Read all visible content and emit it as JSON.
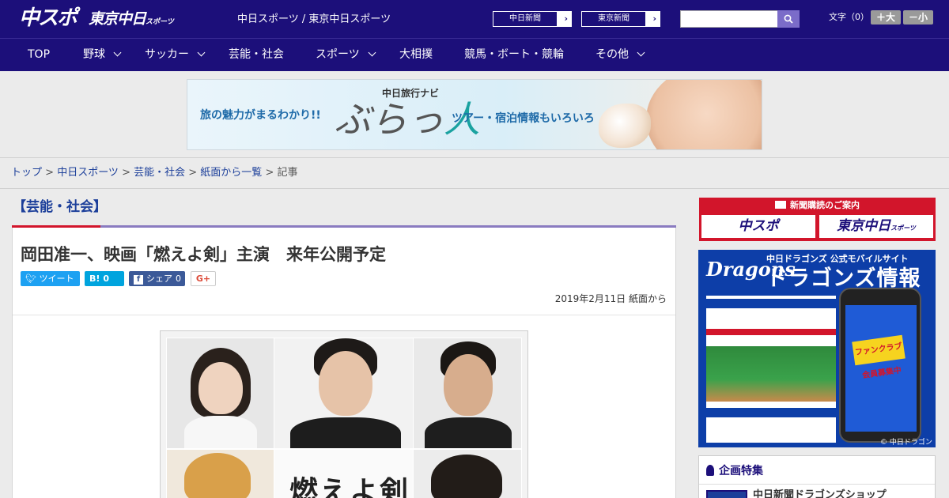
{
  "header": {
    "logo_main": "中スポ",
    "logo_tokyo": "東京中日",
    "logo_tokyo_small": "スポーツ",
    "site_name": "中日スポーツ / 東京中日スポーツ",
    "links": [
      {
        "label": "中日新聞"
      },
      {
        "label": "東京新聞"
      }
    ],
    "search": {
      "value": "",
      "placeholder": ""
    },
    "font_size_label": "文字（0）",
    "font_up": "＋大",
    "font_down": "－小"
  },
  "nav": {
    "items": [
      {
        "label": "TOP",
        "has_menu": false
      },
      {
        "label": "野球",
        "has_menu": true
      },
      {
        "label": "サッカー",
        "has_menu": true
      },
      {
        "label": "芸能・社会",
        "has_menu": false
      },
      {
        "label": "スポーツ",
        "has_menu": true
      },
      {
        "label": "大相撲",
        "has_menu": false
      },
      {
        "label": "競馬・ボート・競輪",
        "has_menu": false
      },
      {
        "label": "その他",
        "has_menu": true
      }
    ]
  },
  "banner": {
    "left_text": "旅の魅力がまるわかり!!",
    "brand": "中日旅行ナビ",
    "logo_a": "ぶらっ",
    "logo_b": "人",
    "right_text": "ツアー・宿泊情報もいろいろ"
  },
  "breadcrumb": {
    "items": [
      "トップ",
      "中日スポーツ",
      "芸能・社会",
      "紙面から一覧"
    ],
    "current": "記事",
    "sep": " > "
  },
  "article": {
    "category": "【芸能・社会】",
    "headline": "岡田准一、映画「燃えよ剣」主演　来年公開予定",
    "share": {
      "tweet_label": "ツイート",
      "hatena_label": "B!",
      "hatena_count": "0",
      "facebook_label": "シェア",
      "facebook_count": "0",
      "gplus_label": "G+"
    },
    "date": "2019年2月11日 紙面から",
    "photo_title": "燃えよ剣"
  },
  "sidebar": {
    "subscribe_header": "新聞購読のご案内",
    "subscribe_buttons": [
      {
        "label": "中スポ",
        "small": ""
      },
      {
        "label": "東京中日",
        "small": "スポーツ"
      }
    ],
    "dragons": {
      "logo": "Dragons",
      "subtitle": "中日ドラゴンズ 公式モバイルサイト",
      "title": "ドラゴンズ情報",
      "badge": "ファンクラブ会員募集中",
      "copyright": "© 中日ドラゴンズ"
    },
    "feature": {
      "header": "企画特集",
      "item": "中日新聞ドラゴンズショップ"
    }
  },
  "colors": {
    "header_bg": "#1c0f7a",
    "accent_red": "#d2152b",
    "link": "#1c3f9a",
    "dragons_blue": "#0d3ea8"
  }
}
